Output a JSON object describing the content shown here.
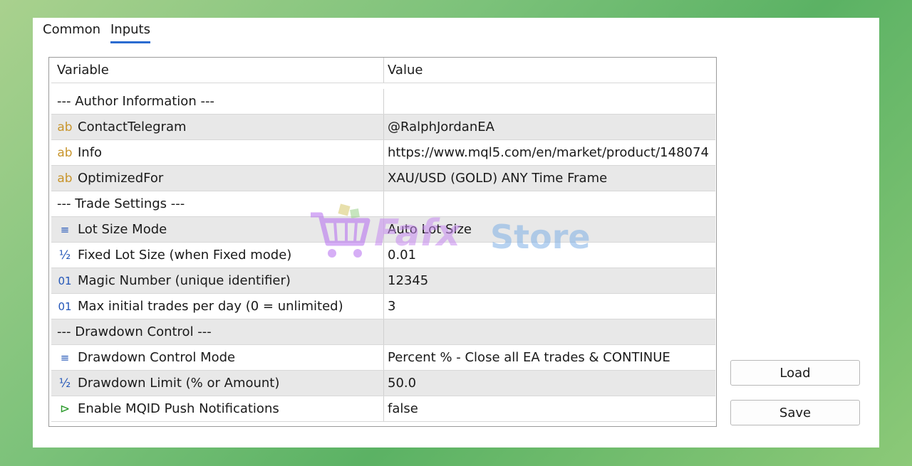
{
  "tabs": [
    {
      "label": "Common"
    },
    {
      "label": "Inputs"
    }
  ],
  "grid": {
    "columns": {
      "variable": "Variable",
      "value": "Value"
    },
    "rows": [
      {
        "icon": "",
        "variable": "--- Author Information ---",
        "value": ""
      },
      {
        "icon": "ab",
        "variable": "ContactTelegram",
        "value": "@RalphJordanEA"
      },
      {
        "icon": "ab",
        "variable": "Info",
        "value": "https://www.mql5.com/en/market/product/148074"
      },
      {
        "icon": "ab",
        "variable": "OptimizedFor",
        "value": "XAU/USD (GOLD) ANY Time Frame"
      },
      {
        "icon": "",
        "variable": "--- Trade Settings ---",
        "value": ""
      },
      {
        "icon": "≡",
        "variable": "Lot Size Mode",
        "value": "Auto Lot Size"
      },
      {
        "icon": "½",
        "variable": "Fixed Lot Size (when Fixed mode)",
        "value": "0.01"
      },
      {
        "icon": "01",
        "variable": "Magic Number (unique identifier)",
        "value": "12345"
      },
      {
        "icon": "01",
        "variable": "Max initial trades per day (0 = unlimited)",
        "value": "3"
      },
      {
        "icon": "",
        "variable": "--- Drawdown Control ---",
        "value": ""
      },
      {
        "icon": "≡",
        "variable": "Drawdown Control Mode",
        "value": "Percent % - Close all EA trades & CONTINUE"
      },
      {
        "icon": "½",
        "variable": "Drawdown Limit (% or Amount)",
        "value": "50.0"
      },
      {
        "icon": "⊳",
        "variable": "Enable MQID Push Notifications",
        "value": "false"
      }
    ]
  },
  "buttons": {
    "load": "Load",
    "save": "Save"
  },
  "watermark": {
    "part1": "Fafx",
    "part2": "Store"
  }
}
